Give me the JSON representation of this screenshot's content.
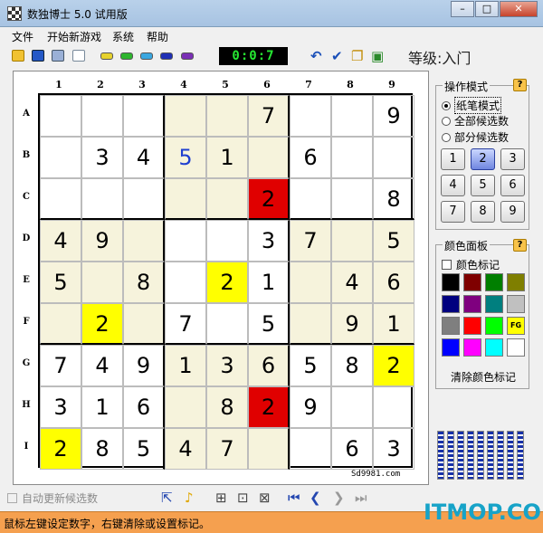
{
  "window": {
    "title": "数独博士 5.0 试用版",
    "min": "–",
    "max": "□",
    "close": "✕"
  },
  "menu": [
    "文件",
    "开始新游戏",
    "系统",
    "帮助"
  ],
  "toolbar": {
    "timer": "0:0:7",
    "level": "等级:入门"
  },
  "columns": [
    "1",
    "2",
    "3",
    "4",
    "5",
    "6",
    "7",
    "8",
    "9"
  ],
  "rows": [
    "A",
    "B",
    "C",
    "D",
    "E",
    "F",
    "G",
    "H",
    "I"
  ],
  "board": [
    [
      "",
      "",
      "",
      "",
      "",
      "7",
      "",
      "",
      "9"
    ],
    [
      "",
      "3",
      "4",
      "5",
      "1",
      "",
      "6",
      "",
      ""
    ],
    [
      "",
      "",
      "",
      "",
      "",
      "2",
      "",
      "",
      "8"
    ],
    [
      "4",
      "9",
      "",
      "",
      "",
      "3",
      "7",
      "",
      "5"
    ],
    [
      "5",
      "",
      "8",
      "",
      "2",
      "1",
      "",
      "4",
      "6"
    ],
    [
      "",
      "2",
      "",
      "7",
      "",
      "5",
      "",
      "9",
      "1"
    ],
    [
      "7",
      "4",
      "9",
      "1",
      "3",
      "6",
      "5",
      "8",
      "2"
    ],
    [
      "3",
      "1",
      "6",
      "",
      "8",
      "2",
      "9",
      "",
      ""
    ],
    [
      "2",
      "8",
      "5",
      "4",
      "7",
      "",
      "",
      "6",
      "3"
    ]
  ],
  "site": "Sd9981.com",
  "operation_panel": {
    "title": "操作模式",
    "help": "?",
    "modes": [
      "纸笔模式",
      "全部候选数",
      "部分候选数"
    ],
    "selected_mode": "纸笔模式",
    "numbers": [
      "1",
      "2",
      "3",
      "4",
      "5",
      "6",
      "7",
      "8",
      "9"
    ],
    "active_number": "2"
  },
  "color_panel": {
    "title": "颜色面板",
    "help": "?",
    "mark_label": "颜色标记",
    "fg": "FG",
    "clear_label": "清除颜色标记",
    "colors": [
      "#000000",
      "#7f0000",
      "#007f00",
      "#7f7f00",
      "#00007f",
      "#7f007f",
      "#007f7f",
      "#c0c0c0",
      "#7f7f7f",
      "#ff0000",
      "#00ff00",
      "#ffff00",
      "#0000ff",
      "#ff00ff",
      "#00ffff",
      "#ffffff"
    ]
  },
  "bottom": {
    "auto_update": "自动更新候选数"
  },
  "status": "鼠标左键设定数字，右键清除或设置标记。",
  "watermark": "ITMOP.COM"
}
